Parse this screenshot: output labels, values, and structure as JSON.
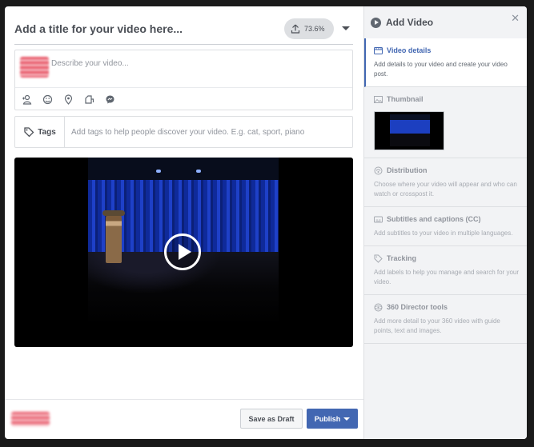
{
  "editor": {
    "title_placeholder": "Add a title for your video here...",
    "upload_progress": "73.6%",
    "description_placeholder": "Describe your video...",
    "tags_label": "Tags",
    "tags_placeholder": "Add tags to help people discover your video. E.g. cat, sport, piano"
  },
  "footer": {
    "save_draft_label": "Save as Draft",
    "publish_label": "Publish"
  },
  "panel": {
    "title": "Add Video",
    "sections": [
      {
        "title": "Video details",
        "desc": "Add details to your video and create your video post.",
        "icon": "film-icon"
      },
      {
        "title": "Thumbnail",
        "desc": "",
        "icon": "image-icon"
      },
      {
        "title": "Distribution",
        "desc": "Choose where your video will appear and who can watch or crosspost it.",
        "icon": "distribution-icon"
      },
      {
        "title": "Subtitles and captions (CC)",
        "desc": "Add subtitles to your video in multiple languages.",
        "icon": "cc-icon"
      },
      {
        "title": "Tracking",
        "desc": "Add labels to help you manage and search for your video.",
        "icon": "tag-icon"
      },
      {
        "title": "360 Director tools",
        "desc": "Add more detail to your 360 video with guide points, text and images.",
        "icon": "360-icon"
      }
    ]
  },
  "colors": {
    "accent": "#4267b2",
    "panel_bg": "#f2f3f5"
  }
}
